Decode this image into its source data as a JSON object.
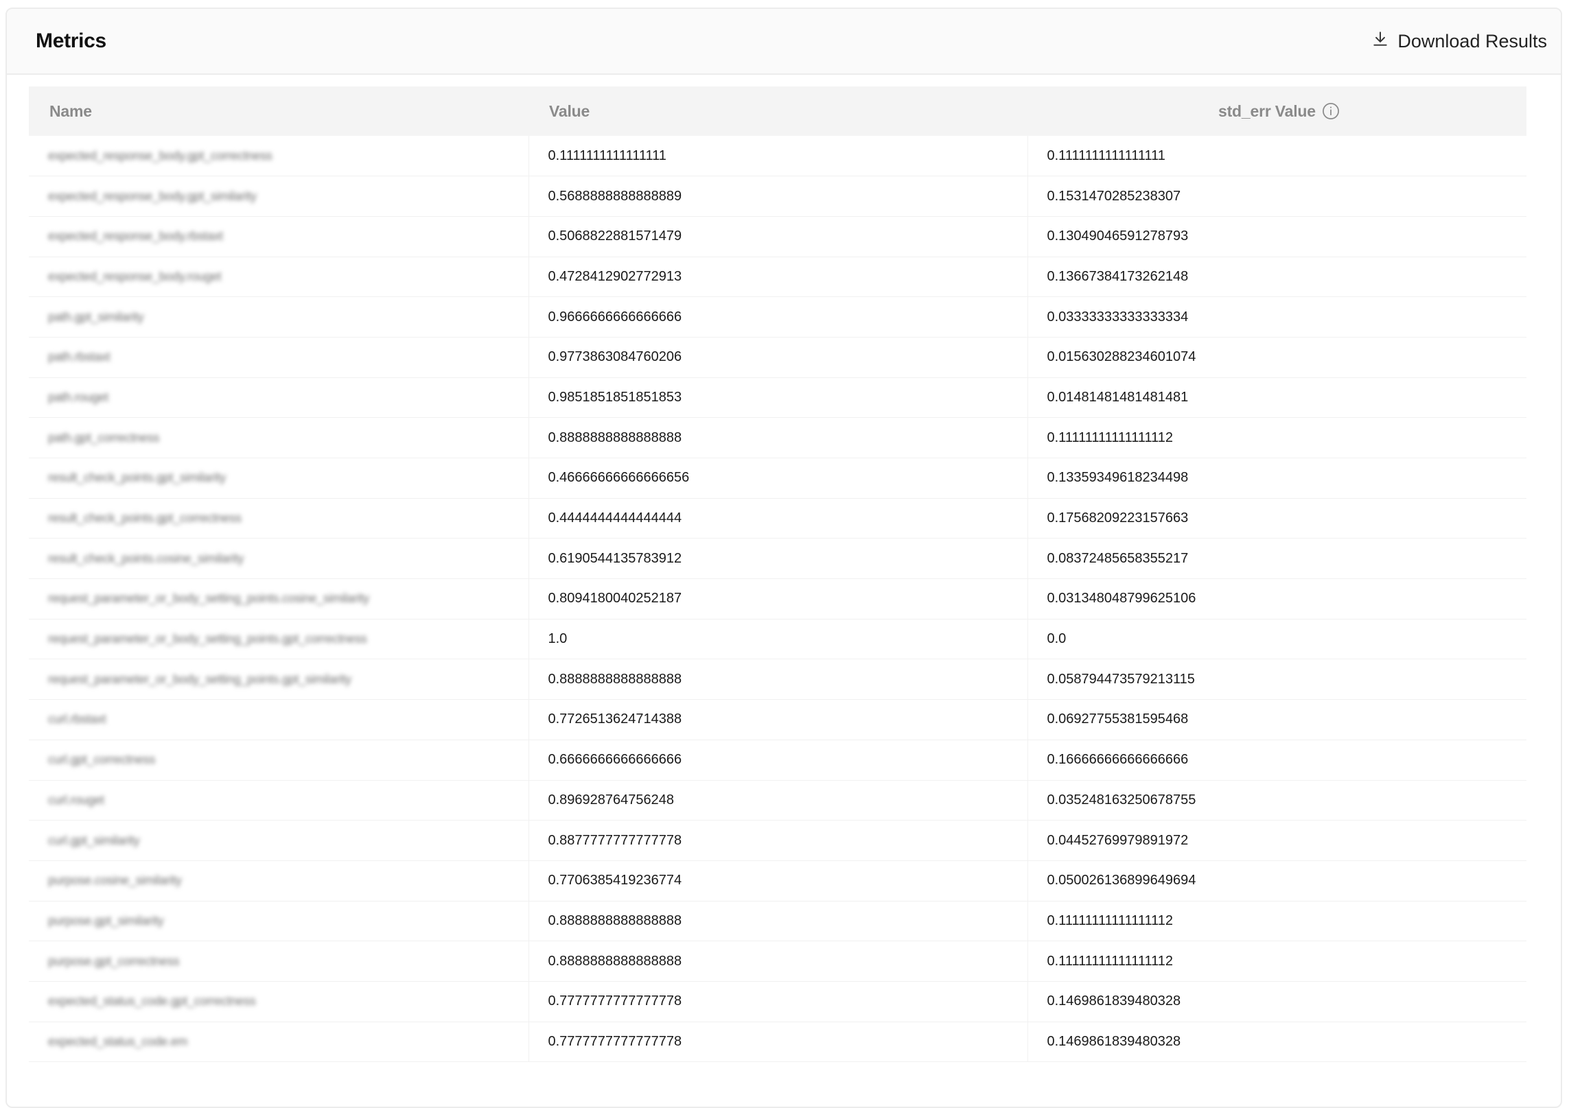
{
  "header": {
    "title": "Metrics",
    "download_label": "Download Results"
  },
  "table": {
    "columns": {
      "name": "Name",
      "value": "Value",
      "std_err": "std_err Value"
    },
    "rows": [
      {
        "name": "expected_response_body.gpt_correctness",
        "value": "0.1111111111111111",
        "std_err": "0.1111111111111111"
      },
      {
        "name": "expected_response_body.gpt_similarity",
        "value": "0.5688888888888889",
        "std_err": "0.1531470285238307"
      },
      {
        "name": "expected_response_body.rbstaxt",
        "value": "0.5068822881571479",
        "std_err": "0.13049046591278793"
      },
      {
        "name": "expected_response_body.rouget",
        "value": "0.4728412902772913",
        "std_err": "0.13667384173262148"
      },
      {
        "name": "path.gpt_similarity",
        "value": "0.9666666666666666",
        "std_err": "0.03333333333333334"
      },
      {
        "name": "path.rbstaxt",
        "value": "0.9773863084760206",
        "std_err": "0.015630288234601074"
      },
      {
        "name": "path.rouget",
        "value": "0.9851851851851853",
        "std_err": "0.01481481481481481"
      },
      {
        "name": "path.gpt_correctness",
        "value": "0.8888888888888888",
        "std_err": "0.11111111111111112"
      },
      {
        "name": "result_check_points.gpt_similarity",
        "value": "0.46666666666666656",
        "std_err": "0.13359349618234498"
      },
      {
        "name": "result_check_points.gpt_correctness",
        "value": "0.4444444444444444",
        "std_err": "0.17568209223157663"
      },
      {
        "name": "result_check_points.cosine_similarity",
        "value": "0.6190544135783912",
        "std_err": "0.08372485658355217"
      },
      {
        "name": "request_parameter_or_body_setting_points.cosine_similarity",
        "value": "0.8094180040252187",
        "std_err": "0.031348048799625106"
      },
      {
        "name": "request_parameter_or_body_setting_points.gpt_correctness",
        "value": "1.0",
        "std_err": "0.0"
      },
      {
        "name": "request_parameter_or_body_setting_points.gpt_similarity",
        "value": "0.8888888888888888",
        "std_err": "0.058794473579213115"
      },
      {
        "name": "curl.rbstaxt",
        "value": "0.7726513624714388",
        "std_err": "0.06927755381595468"
      },
      {
        "name": "curl.gpt_correctness",
        "value": "0.6666666666666666",
        "std_err": "0.16666666666666666"
      },
      {
        "name": "curl.rouget",
        "value": "0.896928764756248",
        "std_err": "0.035248163250678755"
      },
      {
        "name": "curl.gpt_similarity",
        "value": "0.8877777777777778",
        "std_err": "0.04452769979891972"
      },
      {
        "name": "purpose.cosine_similarity",
        "value": "0.7706385419236774",
        "std_err": "0.050026136899649694"
      },
      {
        "name": "purpose.gpt_similarity",
        "value": "0.8888888888888888",
        "std_err": "0.11111111111111112"
      },
      {
        "name": "purpose.gpt_correctness",
        "value": "0.8888888888888888",
        "std_err": "0.11111111111111112"
      },
      {
        "name": "expected_status_code.gpt_correctness",
        "value": "0.7777777777777778",
        "std_err": "0.1469861839480328"
      },
      {
        "name": "expected_status_code.em",
        "value": "0.7777777777777778",
        "std_err": "0.1469861839480328"
      }
    ]
  },
  "icons": {
    "download": "download-icon",
    "info": "info-icon"
  }
}
